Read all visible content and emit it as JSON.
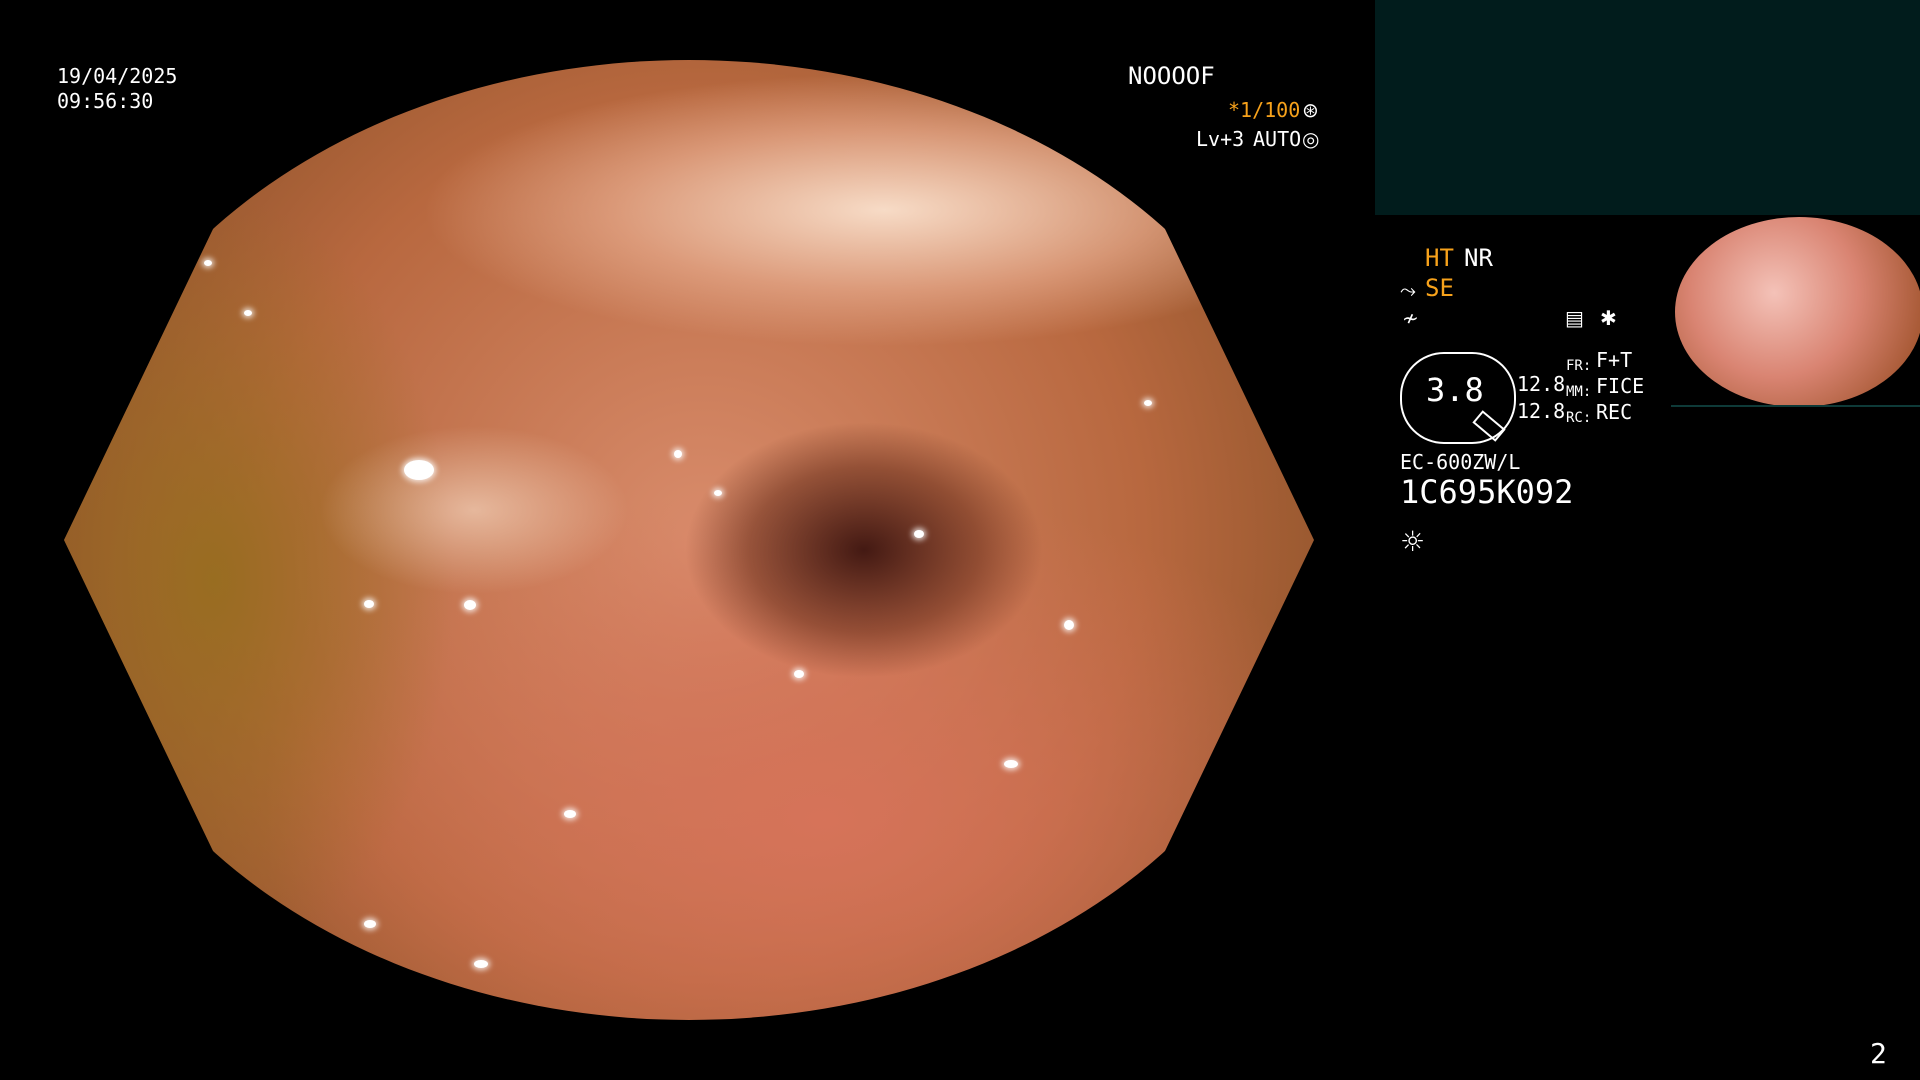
{
  "overlay": {
    "date": "19/04/2025",
    "time": "09:56:30",
    "patient_id": "NOOOOF",
    "shutter": "*1/100",
    "level": "Lv+3",
    "mode": "AUTO",
    "page_number": "2"
  },
  "settings": {
    "ht": "HT",
    "nr": "NR",
    "se": "SE",
    "zoom": "3.8",
    "values": [
      "12.8",
      "12.8"
    ],
    "fr_label": "FR:",
    "fr_value": "F+T",
    "mm_label": "MM:",
    "mm_value": "FICE",
    "rc_label": "RC:",
    "rc_value": "REC",
    "scope_model": "EC-600ZW/L",
    "serial": "1C695K092"
  },
  "icons": {
    "shutter_icon": "aperture-icon",
    "mode_icon": "iris-icon",
    "structure_icon": "structure-enhance-icon",
    "color_icon": "color-enhance-icon",
    "menu_icon": "menu-icon",
    "star_icon": "asterisk-icon",
    "light_icon": "light-icon"
  },
  "colors": {
    "accent": "#f7a21b",
    "panel": "#011c1c"
  }
}
